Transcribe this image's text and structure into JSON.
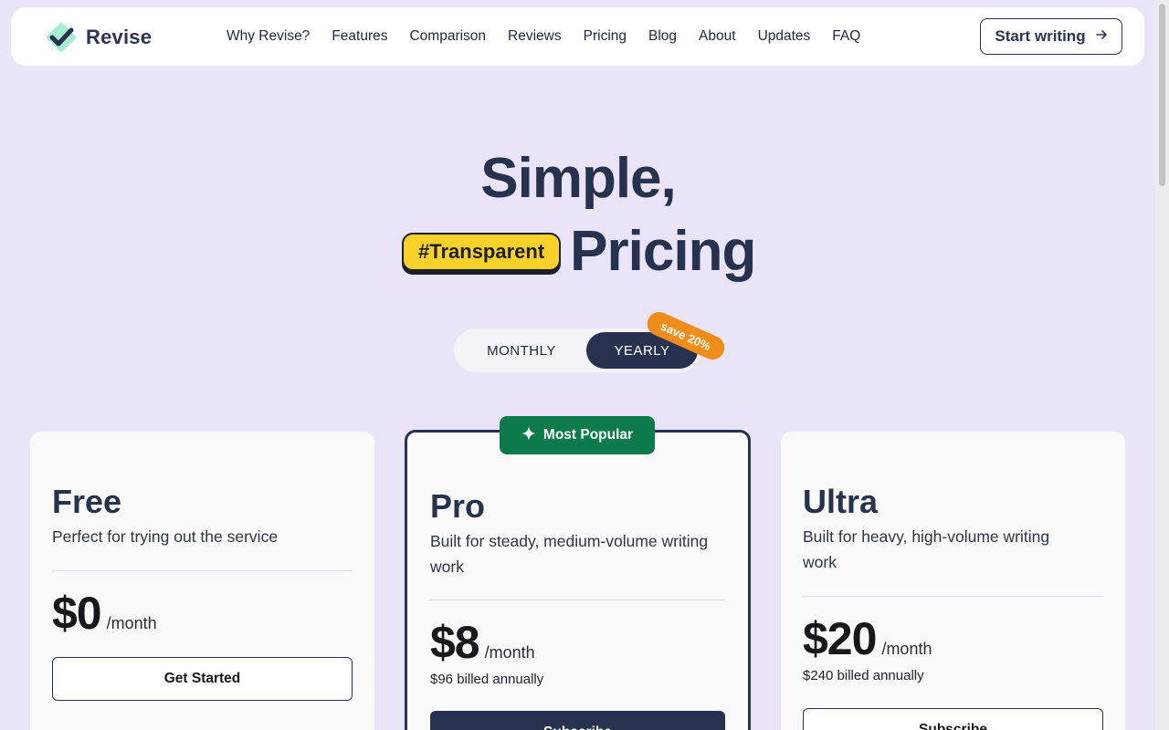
{
  "brand": {
    "name": "Revise",
    "accent": "#27324f",
    "logo_color": "#8fe3c4"
  },
  "nav": {
    "links": [
      "Why Revise?",
      "Features",
      "Comparison",
      "Reviews",
      "Pricing",
      "Blog",
      "About",
      "Updates",
      "FAQ"
    ],
    "cta_label": "Start writing",
    "cta_icon": "arrow-right-icon"
  },
  "hero": {
    "line1": "Simple,",
    "tag": "#Transparent",
    "line2": "Pricing"
  },
  "billing_toggle": {
    "monthly_label": "MONTHLY",
    "yearly_label": "YEARLY",
    "selected": "YEARLY",
    "save_badge": "save 20%"
  },
  "plans": [
    {
      "name": "Free",
      "description": "Perfect for trying out the service",
      "price": "$0",
      "period": "/month",
      "billed": "",
      "button": "Get Started"
    },
    {
      "name": "Pro",
      "badge": "Most Popular",
      "badge_icon": "sparkle-icon",
      "description": "Built for steady, medium-volume writing work",
      "price": "$8",
      "period": "/month",
      "billed": "$96 billed annually",
      "button": "Subscribe"
    },
    {
      "name": "Ultra",
      "description": "Built for heavy, high-volume writing work",
      "price": "$20",
      "period": "/month",
      "billed": "$240 billed annually",
      "button": "Subscribe"
    }
  ]
}
